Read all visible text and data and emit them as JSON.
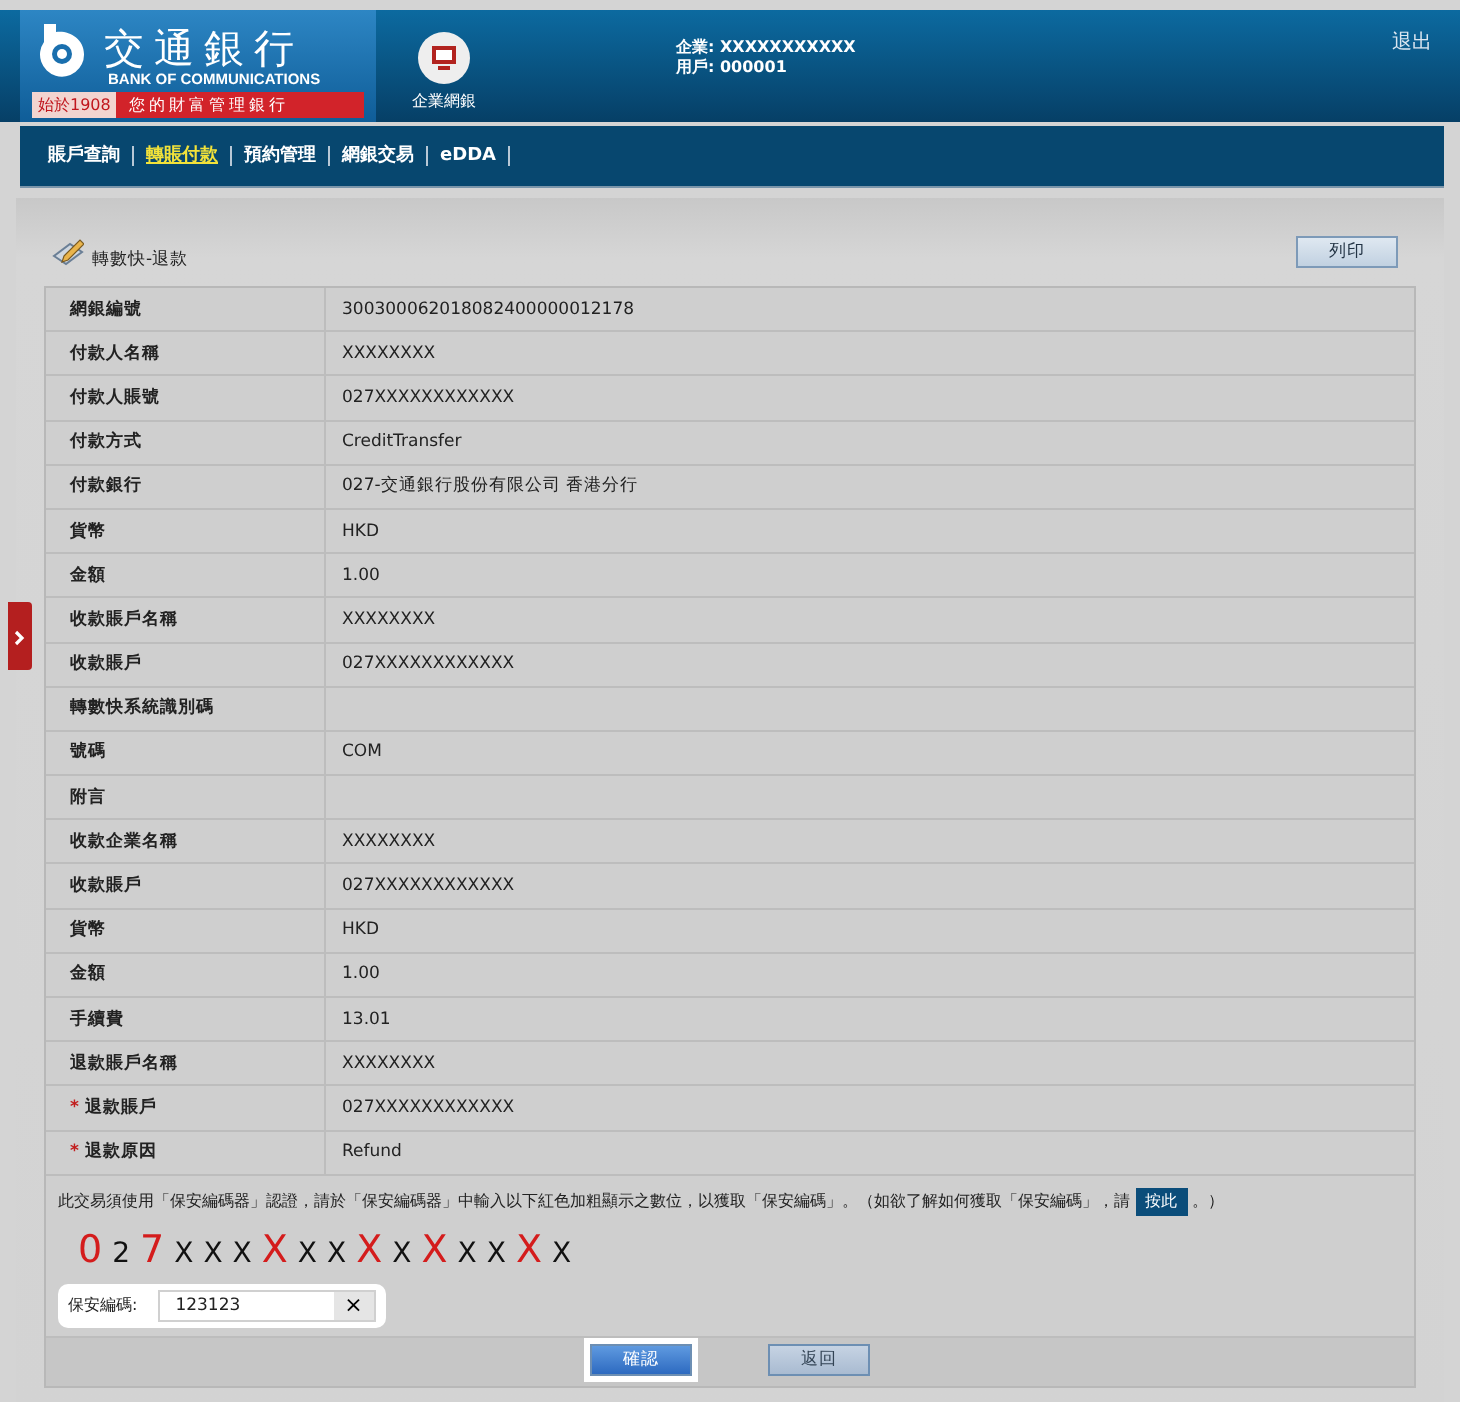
{
  "header": {
    "bank_name": "交通銀行",
    "bank_name_en": "BANK OF COMMUNICATIONS",
    "since": "始於1908",
    "slogan": "您的財富管理銀行",
    "portal_label": "企業網銀",
    "company_label": "企業:",
    "company": "XXXXXXXXXXX",
    "user_label": "用戶:",
    "user": "000001",
    "logout": "退出"
  },
  "nav": [
    {
      "label": "賬戶查詢",
      "selected": false
    },
    {
      "label": "轉賬付款",
      "selected": true
    },
    {
      "label": "預約管理",
      "selected": false
    },
    {
      "label": "網銀交易",
      "selected": false
    },
    {
      "label": "eDDA",
      "selected": false
    }
  ],
  "page": {
    "title": "轉數快-退款",
    "print_button": "列印"
  },
  "details": [
    {
      "label": "網銀編號",
      "value": "300300062018082400000012178"
    },
    {
      "label": "付款人名稱",
      "value": "XXXXXXXX"
    },
    {
      "label": "付款人賬號",
      "value": "027XXXXXXXXXXXX"
    },
    {
      "label": "付款方式",
      "value": "CreditTransfer"
    },
    {
      "label": "付款銀行",
      "value": "027-交通銀行股份有限公司 香港分行"
    },
    {
      "label": "貨幣",
      "value": "HKD"
    },
    {
      "label": "金額",
      "value": "1.00"
    },
    {
      "label": "收款賬戶名稱",
      "value": "XXXXXXXX"
    },
    {
      "label": "收款賬戶",
      "value": "027XXXXXXXXXXXX"
    },
    {
      "label": "轉數快系統識別碼"
    },
    {
      "label": "號碼",
      "value": "COM"
    },
    {
      "label": "附言"
    },
    {
      "label": "收款企業名稱",
      "value": "XXXXXXXX"
    },
    {
      "label": "收款賬戶",
      "value": "027XXXXXXXXXXXX"
    },
    {
      "label": "貨幣",
      "value": "HKD"
    },
    {
      "label": "金額",
      "value": "1.00"
    },
    {
      "label": "手續費",
      "value": "13.01"
    },
    {
      "label": "退款賬戶名稱",
      "value": "XXXXXXXX"
    },
    {
      "marker": "*",
      "label": "退款賬戶",
      "value": "027XXXXXXXXXXXX"
    },
    {
      "marker": "*",
      "label": "退款原因",
      "value": "Refund"
    }
  ],
  "security": {
    "instruction": "此交易須使用「保安編碼器」認證，請於「保安編碼器」中輸入以下紅色加粗顯示之數位，以獲取「保安編碼」。（如欲了解如何獲取「保安編碼」，請",
    "link": "按此",
    "instruction_end": "。）",
    "code": [
      {
        "char": "0",
        "highlighted": true
      },
      {
        "char": "2",
        "highlighted": false
      },
      {
        "char": "7",
        "highlighted": true
      },
      {
        "char": "X",
        "highlighted": false
      },
      {
        "char": "X",
        "highlighted": false
      },
      {
        "char": "X",
        "highlighted": false
      },
      {
        "char": "X",
        "highlighted": true
      },
      {
        "char": "X",
        "highlighted": false
      },
      {
        "char": "X",
        "highlighted": false
      },
      {
        "char": "X",
        "highlighted": true
      },
      {
        "char": "X",
        "highlighted": false
      },
      {
        "char": "X",
        "highlighted": true
      },
      {
        "char": "X",
        "highlighted": false
      },
      {
        "char": "X",
        "highlighted": false
      },
      {
        "char": "X",
        "highlighted": true
      },
      {
        "char": "X",
        "highlighted": false
      }
    ],
    "field_label": "保安編碼:",
    "field_value": "123123",
    "clear": "×"
  },
  "buttons": [
    {
      "label": "確認",
      "kind": "primary"
    },
    {
      "label": "返回",
      "kind": "secondary"
    }
  ]
}
